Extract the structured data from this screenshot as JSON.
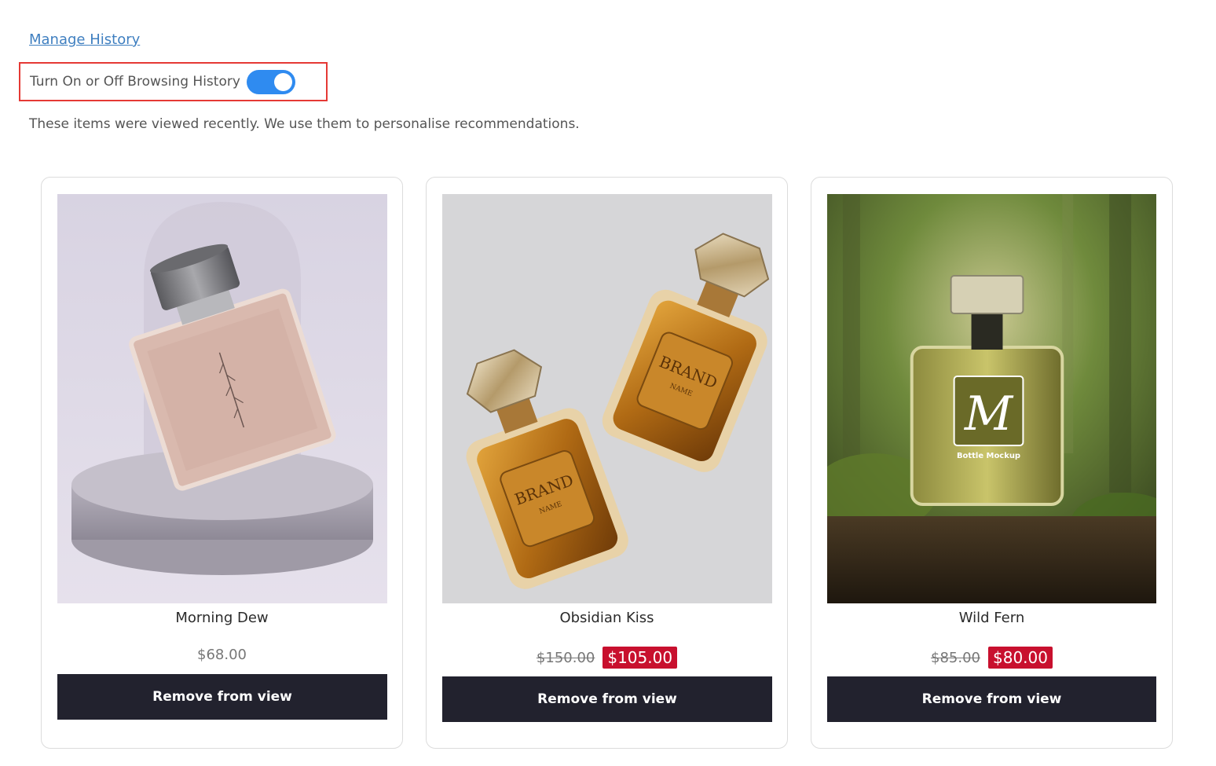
{
  "manage_history": {
    "label": "Manage History"
  },
  "browsing_toggle": {
    "label": "Turn On or Off Browsing History",
    "enabled": true
  },
  "info_text": "These items were viewed recently. We use them to personalise recommendations.",
  "products": [
    {
      "name": "Morning Dew",
      "price": "$68.00",
      "remove_label": "Remove from view"
    },
    {
      "name": "Obsidian Kiss",
      "original_price": "$150.00",
      "sale_price": "$105.00",
      "remove_label": "Remove from view"
    },
    {
      "name": "Wild Fern",
      "original_price": "$85.00",
      "sale_price": "$80.00",
      "remove_label": "Remove from view"
    }
  ],
  "image_text": {
    "brand": "BRAND",
    "brand_sub": "NAME",
    "monogram": "M",
    "mockup": "Bottle Mockup"
  },
  "colors": {
    "link": "#3f7fc0",
    "toggle_on": "#2f8bf0",
    "highlight_border": "#e53935",
    "sale_badge": "#c8102e",
    "button": "#22222e"
  }
}
